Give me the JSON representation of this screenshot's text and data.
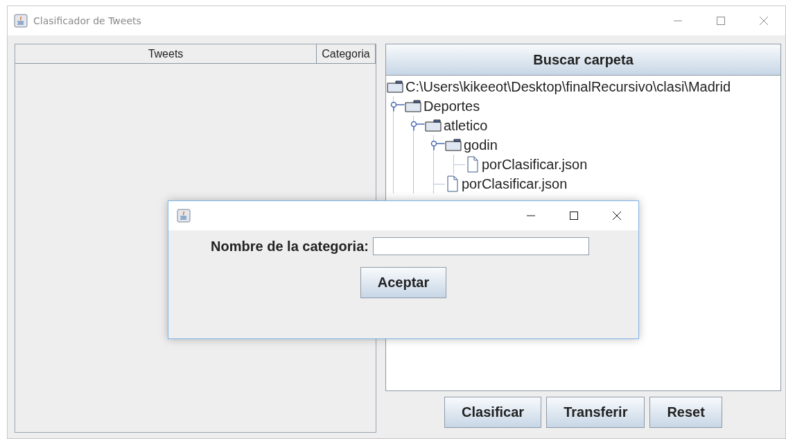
{
  "window": {
    "title": "Clasificador de Tweets"
  },
  "table": {
    "columns": [
      "Tweets",
      "Categoria"
    ]
  },
  "browse_button": "Buscar carpeta",
  "tree": {
    "label": "C:\\Users\\kikeeot\\Desktop\\finalRecursivo\\clasi\\Madrid",
    "kind": "folder",
    "children": [
      {
        "label": "Deportes",
        "kind": "folder",
        "expanded": true,
        "children": [
          {
            "label": "atletico",
            "kind": "folder",
            "expanded": true,
            "children": [
              {
                "label": "godin",
                "kind": "folder",
                "expanded": true,
                "children": [
                  {
                    "label": "porClasificar.json",
                    "kind": "file"
                  }
                ]
              },
              {
                "label": "porClasificar.json",
                "kind": "file"
              }
            ]
          }
        ]
      }
    ]
  },
  "actions": [
    "Clasificar",
    "Transferir",
    "Reset"
  ],
  "dialog": {
    "label": "Nombre de la categoria:",
    "button": "Aceptar"
  }
}
